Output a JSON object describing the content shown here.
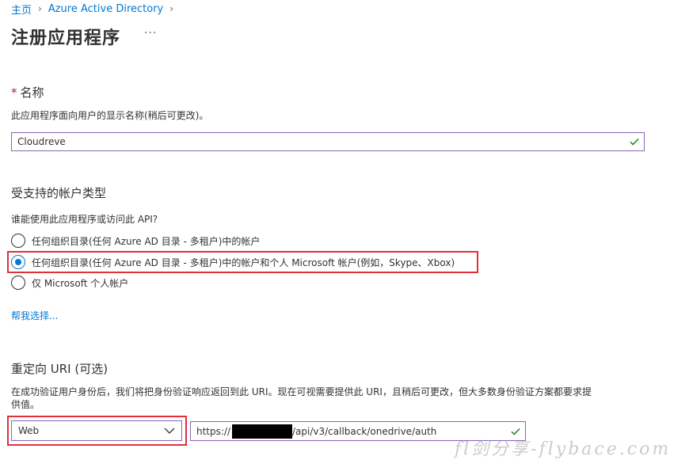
{
  "breadcrumb": {
    "items": [
      "主页",
      "Azure Active Directory"
    ]
  },
  "page": {
    "title": "注册应用程序",
    "more_label": "···"
  },
  "name_section": {
    "required_mark": "*",
    "label": "名称",
    "help": "此应用程序面向用户的显示名称(稍后可更改)。",
    "value": "Cloudreve"
  },
  "account_types": {
    "label": "受支持的帐户类型",
    "question": "谁能使用此应用程序或访问此 API?",
    "options": [
      {
        "label": "任何组织目录(任何 Azure AD 目录 - 多租户)中的帐户",
        "selected": false
      },
      {
        "label": "任何组织目录(任何 Azure AD 目录 - 多租户)中的帐户和个人 Microsoft 帐户(例如，Skype、Xbox)",
        "selected": true
      },
      {
        "label": "仅 Microsoft 个人帐户",
        "selected": false
      }
    ],
    "help_link": "帮我选择..."
  },
  "redirect_uri": {
    "label": "重定向 URI (可选)",
    "help_line1": "在成功验证用户身份后，我们将把身份验证响应返回到此 URI。现在可视需要提供此 URI，且稍后可更改，但大多数身份验证方案都要求提",
    "help_line2": "供值。",
    "platform_value": "Web",
    "uri_prefix": "https://",
    "uri_suffix": "/api/v3/callback/onedrive/auth"
  },
  "watermark": "fl剑分享-flybace.com",
  "colors": {
    "link": "#0078d4",
    "required": "#a4262c",
    "valid_check": "#107c10",
    "focus_border": "#8764b8",
    "highlight": "#e0303a"
  },
  "icons": {
    "breadcrumb_separator": "chevron-right-icon",
    "valid": "checkmark-icon",
    "dropdown": "chevron-down-icon"
  }
}
